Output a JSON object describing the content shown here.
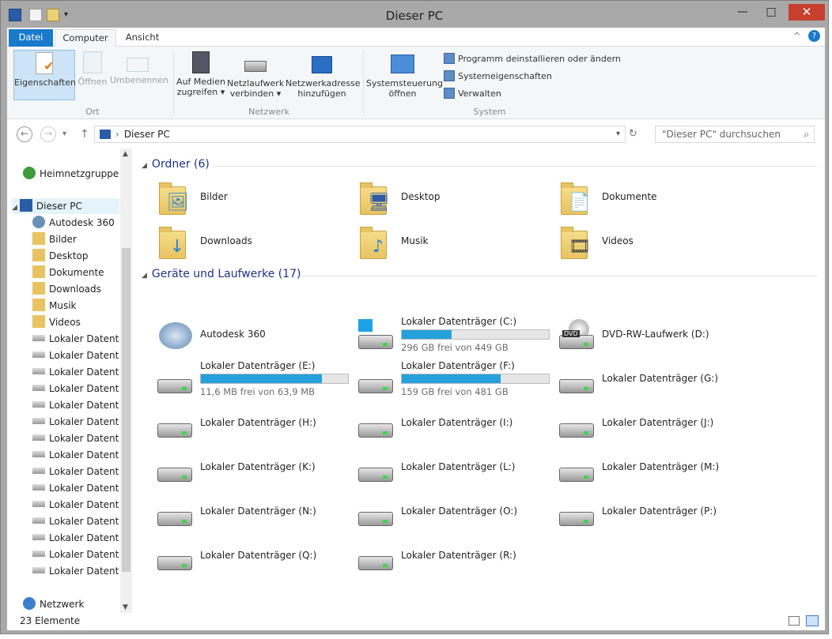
{
  "window": {
    "title": "Dieser PC",
    "minimize_glyph": "—",
    "maximize_glyph": "□",
    "close_glyph": "✕"
  },
  "ribbon_tabs": [
    {
      "label": "Datei"
    },
    {
      "label": "Computer"
    },
    {
      "label": "Ansicht"
    }
  ],
  "ribbon": {
    "ort": {
      "label": "Ort",
      "buttons": [
        "Eigenschaften",
        "Öffnen",
        "Umbenennen"
      ]
    },
    "netzwerk": {
      "label": "Netzwerk",
      "buttons": [
        {
          "l1": "Auf Medien",
          "l2": "zugreifen ▾"
        },
        {
          "l1": "Netzlaufwerk",
          "l2": "verbinden ▾"
        },
        {
          "l1": "Netzwerkadresse",
          "l2": "hinzufügen"
        }
      ]
    },
    "system": {
      "label": "System",
      "big": {
        "l1": "Systemsteuerung",
        "l2": "öffnen"
      },
      "small": [
        "Programm deinstallieren oder ändern",
        "Systemeigenschaften",
        "Verwalten"
      ]
    }
  },
  "address": {
    "path": "Dieser PC",
    "search_placeholder": "\"Dieser PC\" durchsuchen",
    "sep": "›"
  },
  "nav": {
    "homegroup": "Heimnetzgruppe",
    "thispc": "Dieser PC",
    "children": [
      "Autodesk 360",
      "Bilder",
      "Desktop",
      "Dokumente",
      "Downloads",
      "Musik",
      "Videos",
      "Lokaler Datenträger",
      "Lokaler Datenträger",
      "Lokaler Datenträger",
      "Lokaler Datenträger",
      "Lokaler Datenträger",
      "Lokaler Datenträger",
      "Lokaler Datenträger",
      "Lokaler Datenträger",
      "Lokaler Datenträger",
      "Lokaler Datenträger",
      "Lokaler Datenträger",
      "Lokaler Datenträger",
      "Lokaler Datenträger",
      "Lokaler Datenträger",
      "Lokaler Datenträger"
    ],
    "network": "Netzwerk"
  },
  "sections": {
    "folders": "Ordner (6)",
    "drives": "Geräte und Laufwerke (17)"
  },
  "folders": [
    "Bilder",
    "Desktop",
    "Dokumente",
    "Downloads",
    "Musik",
    "Videos"
  ],
  "drives": [
    {
      "name": "Autodesk 360"
    },
    {
      "name": "Lokaler Datenträger (C:)",
      "free": "296 GB frei von 449 GB",
      "used_fraction": 0.34
    },
    {
      "name": "DVD-RW-Laufwerk (D:)"
    },
    {
      "name": "Lokaler Datenträger (E:)",
      "free": "11,6 MB frei von 63,9 MB",
      "used_fraction": 0.82
    },
    {
      "name": "Lokaler Datenträger (F:)",
      "free": "159 GB frei von 481 GB",
      "used_fraction": 0.67
    },
    {
      "name": "Lokaler Datenträger (G:)"
    },
    {
      "name": "Lokaler Datenträger (H:)"
    },
    {
      "name": "Lokaler Datenträger (I:)"
    },
    {
      "name": "Lokaler Datenträger (J:)"
    },
    {
      "name": "Lokaler Datenträger (K:)"
    },
    {
      "name": "Lokaler Datenträger (L:)"
    },
    {
      "name": "Lokaler Datenträger (M:)"
    },
    {
      "name": "Lokaler Datenträger (N:)"
    },
    {
      "name": "Lokaler Datenträger (O:)"
    },
    {
      "name": "Lokaler Datenträger (P:)"
    },
    {
      "name": "Lokaler Datenträger (Q:)"
    },
    {
      "name": "Lokaler Datenträger (R:)"
    }
  ],
  "status": {
    "count": "23 Elemente"
  },
  "colors": {
    "accent": "#1979ca",
    "bar": "#26a0da",
    "close": "#c7402d"
  }
}
